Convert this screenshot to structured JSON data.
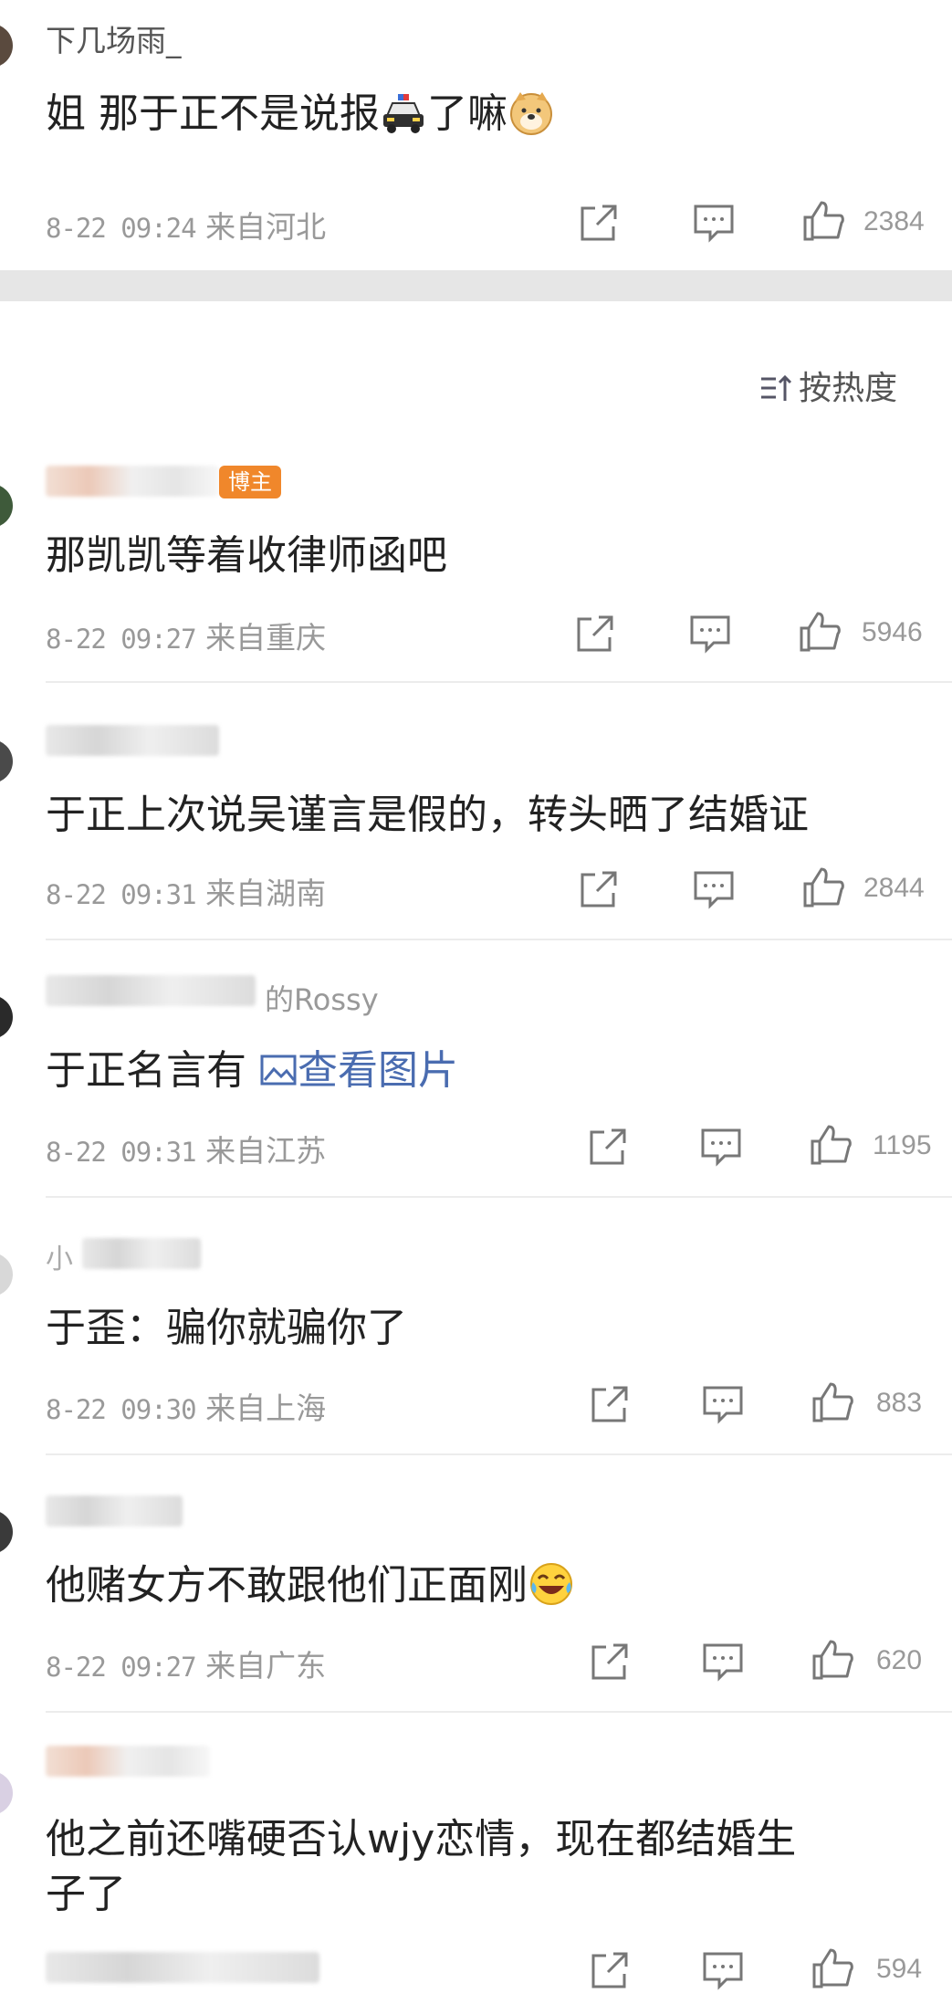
{
  "sort_label": "按热度",
  "comments": [
    {
      "username": "下几场雨_",
      "text": "姐 那于正不是说报",
      "text_tail": "了嘛",
      "date": "8-22 09:24",
      "location": "来自河北",
      "likes": "2384"
    },
    {
      "username": "",
      "badge": "博主",
      "text": "那凯凯等着收律师函吧",
      "date": "8-22 09:27",
      "location": "来自重庆",
      "likes": "5946"
    },
    {
      "username": "",
      "text": "于正上次说吴谨言是假的，转头晒了结婚证",
      "date": "8-22 09:31",
      "location": "来自湖南",
      "likes": "2844"
    },
    {
      "username": "的Rossy",
      "text": "于正名言有",
      "image_link": "查看图片",
      "date": "8-22 09:31",
      "location": "来自江苏",
      "likes": "1195"
    },
    {
      "username": "小",
      "text": "于歪：骗你就骗你了",
      "date": "8-22 09:30",
      "location": "来自上海",
      "likes": "883"
    },
    {
      "username": "",
      "text": "他赌女方不敢跟他们正面刚",
      "date": "8-22 09:27",
      "location": "来自广东",
      "likes": "620"
    },
    {
      "username": "",
      "text_line1": "他之前还嘴硬否认wjy恋情，现在都结婚生",
      "text_line2": "子了",
      "likes": "594"
    }
  ]
}
